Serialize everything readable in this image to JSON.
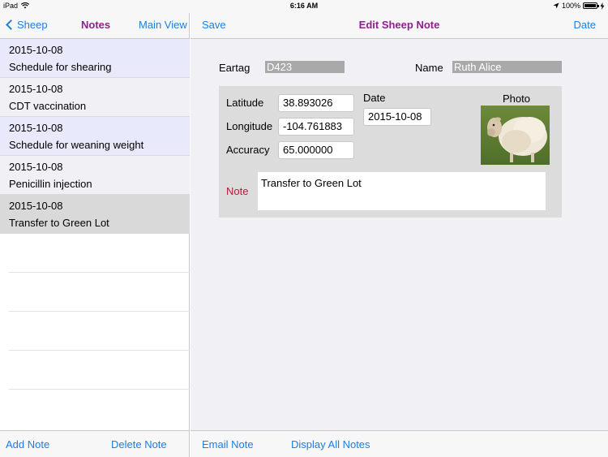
{
  "status": {
    "device": "iPad",
    "time": "6:16 AM",
    "battery": "100%",
    "battery_level": 1.0
  },
  "master": {
    "back_label": "Sheep",
    "title": "Notes",
    "right_button": "Main View",
    "notes": [
      {
        "date": "2015-10-08",
        "text": "Schedule for shearing"
      },
      {
        "date": "2015-10-08",
        "text": "CDT vaccination"
      },
      {
        "date": "2015-10-08",
        "text": "Schedule for weaning weight"
      },
      {
        "date": "2015-10-08",
        "text": "Penicillin injection"
      },
      {
        "date": "2015-10-08",
        "text": "Transfer to Green Lot"
      }
    ],
    "add_note": "Add Note",
    "delete_note": "Delete Note"
  },
  "detail": {
    "save_label": "Save",
    "title": "Edit Sheep Note",
    "date_button": "Date",
    "eartag_label": "Eartag",
    "eartag_value": "D423",
    "name_label": "Name",
    "name_value": "Ruth Alice",
    "latitude_label": "Latitude",
    "latitude_value": "38.893026",
    "longitude_label": "Longitude",
    "longitude_value": "-104.761883",
    "accuracy_label": "Accuracy",
    "accuracy_value": "65.000000",
    "date_label": "Date",
    "date_value": "2015-10-08",
    "photo_label": "Photo",
    "note_label": "Note",
    "note_value": "Transfer to Green Lot",
    "email_note": "Email Note",
    "display_all": "Display All Notes"
  },
  "colors": {
    "accent": "#1a7ee8",
    "title": "#8e1f8e",
    "note_label": "#c0143c"
  }
}
